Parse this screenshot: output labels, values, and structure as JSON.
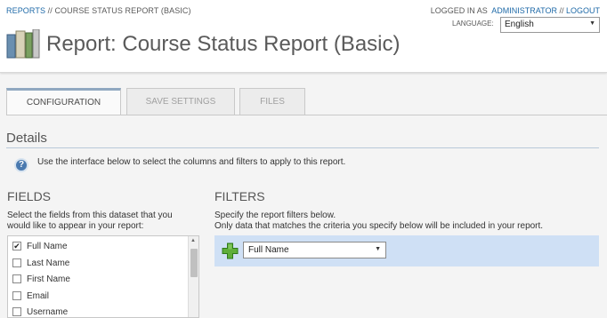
{
  "breadcrumb": {
    "reports": "REPORTS",
    "sep": " // ",
    "current": "COURSE STATUS REPORT (BASIC)"
  },
  "userbar": {
    "logged_in_as": "LOGGED IN AS",
    "user": "ADMINISTRATOR",
    "sep": " // ",
    "logout": "LOGOUT"
  },
  "language": {
    "label": "LANGUAGE:",
    "value": "English"
  },
  "page": {
    "title": "Report: Course Status Report (Basic)"
  },
  "tabs": [
    {
      "label": "CONFIGURATION",
      "active": true
    },
    {
      "label": "SAVE SETTINGS",
      "active": false
    },
    {
      "label": "FILES",
      "active": false
    }
  ],
  "details": {
    "title": "Details",
    "info_icon": "help-icon",
    "info_text": "Use the interface below to select the columns and filters to apply to this report."
  },
  "fields": {
    "title": "FIELDS",
    "desc_line1": "Select the fields from this dataset that you",
    "desc_line2": "would like to appear in your report:",
    "items": [
      {
        "label": "Full Name",
        "checked": true
      },
      {
        "label": "Last Name",
        "checked": false
      },
      {
        "label": "First Name",
        "checked": false
      },
      {
        "label": "Email",
        "checked": false
      },
      {
        "label": "Username",
        "checked": false
      }
    ]
  },
  "filters": {
    "title": "FILTERS",
    "desc_line1": "Specify the report filters below.",
    "desc_line2": "Only data that matches the criteria you specify below will be included in your report.",
    "add_icon": "add-plus-icon",
    "select_value": "Full Name"
  },
  "colors": {
    "link": "#1f6aa8",
    "filter_bar": "#cfe0f5",
    "accent": "#4a7ab0"
  }
}
